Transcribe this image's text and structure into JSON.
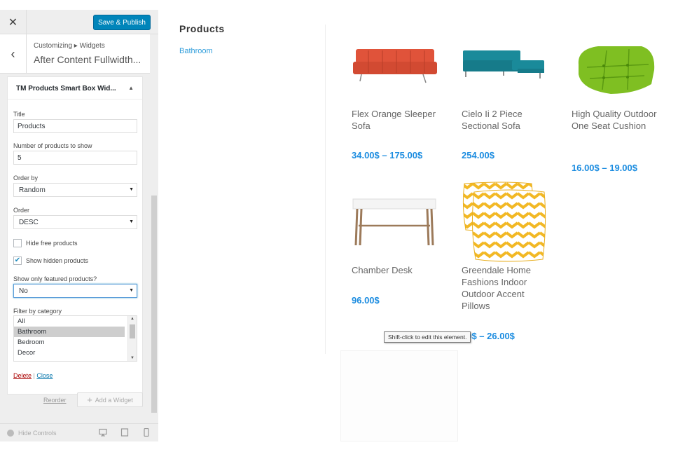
{
  "toolbar": {
    "close_glyph": "✕",
    "publish_label": "Save & Publish"
  },
  "section": {
    "back_glyph": "‹",
    "breadcrumb": "Customizing ▸ Widgets",
    "title": "After Content Fullwidth..."
  },
  "widget": {
    "title": "TM Products Smart Box Wid...",
    "caret": "▲",
    "fields": {
      "title_label": "Title",
      "title_value": "Products",
      "count_label": "Number of products to show",
      "count_value": "5",
      "orderby_label": "Order by",
      "orderby_value": "Random",
      "order_label": "Order",
      "order_value": "DESC",
      "hide_free_label": "Hide free products",
      "hide_free_checked": false,
      "show_hidden_label": "Show hidden products",
      "show_hidden_checked": true,
      "featured_label": "Show only featured products?",
      "featured_value": "No",
      "category_label": "Filter by category",
      "categories": [
        "All",
        "Bathroom",
        "Bedroom",
        "Decor"
      ],
      "selected_category": "Bathroom"
    },
    "delete_label": "Delete",
    "separator": "|",
    "close_label": "Close"
  },
  "actions": {
    "reorder_label": "Reorder",
    "add_widget_label": "Add a Widget"
  },
  "footer": {
    "hide_controls_label": "Hide Controls"
  },
  "preview": {
    "title": "Products",
    "category_link": "Bathroom",
    "products": [
      {
        "name": "Flex Orange Sleeper Sofa",
        "price": "34.00$ – 175.00$"
      },
      {
        "name": "Cielo Ii 2 Piece Sectional Sofa",
        "price": "254.00$"
      },
      {
        "name": "High Quality Outdoor One Seat Cushion",
        "price": "16.00$ – 19.00$"
      },
      {
        "name": "Chamber Desk",
        "price": "96.00$"
      },
      {
        "name": "Greendale Home Fashions Indoor Outdoor Accent Pillows",
        "price": "00$ – 26.00$"
      }
    ],
    "tooltip": "Shift-click to edit this element."
  },
  "colors": {
    "accent": "#0085ba",
    "price": "#1b8ce0",
    "link": "#2f9ddb"
  }
}
